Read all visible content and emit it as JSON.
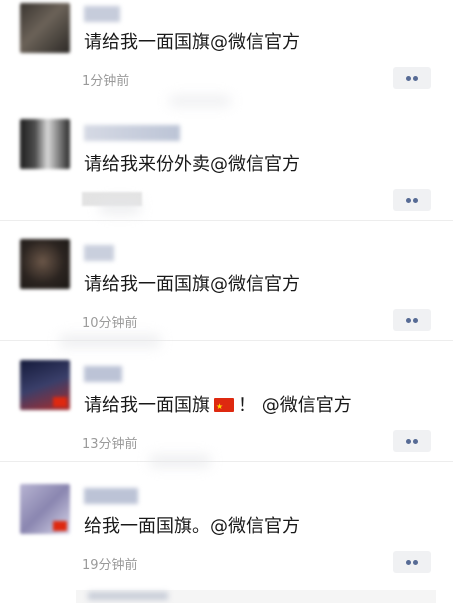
{
  "posts": [
    {
      "content": "请给我一面国旗@微信官方",
      "time": "1分钟前",
      "avatar_colors": [
        "#3a3530",
        "#6b6258",
        "#2d2a27"
      ]
    },
    {
      "content": "请给我来份外卖@微信官方",
      "time": "",
      "avatar_colors": [
        "#1f1f1f",
        "#d8d8d8",
        "#4d4d4d"
      ]
    },
    {
      "content": "请给我一面国旗@微信官方",
      "time": "10分钟前",
      "avatar_colors": [
        "#2b2420",
        "#6a5648",
        "#1a1714"
      ]
    },
    {
      "content_before_flag": "请给我一面国旗",
      "content_after_flag": "！ @微信官方",
      "time": "13分钟前",
      "avatar_colors": [
        "#141a3a",
        "#3a3f6a",
        "#aa2a2a"
      ]
    },
    {
      "content": "给我一面国旗。@微信官方",
      "time": "19分钟前",
      "avatar_colors": [
        "#8a86b0",
        "#b7b4d2",
        "#d8d6ea"
      ]
    }
  ],
  "icons": {
    "more": "more-dots-icon",
    "flag": "china-flag-icon"
  },
  "colors": {
    "name_link": "#576b95",
    "time": "#9a9a9a",
    "text": "#191919",
    "more_bg": "#f0f1f3",
    "flag_red": "#de2910"
  }
}
